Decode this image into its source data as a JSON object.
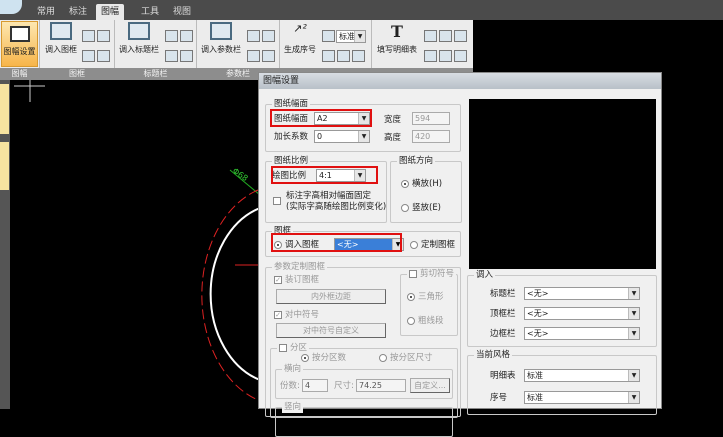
{
  "ribbon": {
    "tabs": [
      "常用",
      "标注",
      "图幅",
      "工具",
      "视图"
    ],
    "active_tab": "图幅",
    "groups": [
      {
        "label": "图幅",
        "button": "图幅设置"
      },
      {
        "label": "图框",
        "button": "调入图框"
      },
      {
        "label": "标题栏",
        "button": "调入标题栏"
      },
      {
        "label": "参数栏",
        "button": "调入参数栏"
      },
      {
        "label": "",
        "button": "生成序号",
        "style_select": "标准"
      },
      {
        "label": "",
        "button": "填写明细表"
      }
    ]
  },
  "canvas": {
    "dimension_text": "Φ68"
  },
  "dialog": {
    "title": "图幅设置",
    "paper_size": {
      "group": "图纸幅面",
      "size_label": "图纸幅面",
      "size_value": "A2",
      "ext_label": "加长系数",
      "ext_value": "0",
      "width_label": "宽度",
      "width_value": "594",
      "height_label": "高度",
      "height_value": "420"
    },
    "scale": {
      "group": "图纸比例",
      "label": "绘图比例",
      "value": "4:1",
      "fix_text_line1": "标注字高相对幅面固定",
      "fix_text_line2": "(实际字高随绘图比例变化)"
    },
    "orientation": {
      "group": "图纸方向",
      "landscape": "横放(H)",
      "portrait": "竖放(E)"
    },
    "frame": {
      "group": "图框",
      "load_label": "调入图框",
      "load_value": "<无>",
      "custom_label": "定制图框"
    },
    "param_frame": {
      "group": "参数定制图框",
      "binding_frame": "装订图框",
      "margin_button": "内外框边距",
      "center_mark": "对中符号",
      "center_button": "对中符号自定义",
      "cut_mark": "剪切符号",
      "triangle": "三角形",
      "thick_line": "粗线段",
      "zone": "分区",
      "by_count": "按分区数",
      "by_size": "按分区尺寸",
      "horizontal": "横向",
      "count_label": "份数:",
      "count_value": "4",
      "size_label": "尺寸:",
      "size_value": "74.25",
      "custom_button": "自定义...",
      "vertical": "竖向"
    },
    "load": {
      "group": "调入",
      "rows": [
        {
          "label": "标题栏",
          "value": "<无>"
        },
        {
          "label": "顶框栏",
          "value": "<无>"
        },
        {
          "label": "边框栏",
          "value": "<无>"
        }
      ]
    },
    "style": {
      "group": "当前风格",
      "rows": [
        {
          "label": "明细表",
          "value": "标准"
        },
        {
          "label": "序号",
          "value": "标准"
        }
      ]
    }
  }
}
